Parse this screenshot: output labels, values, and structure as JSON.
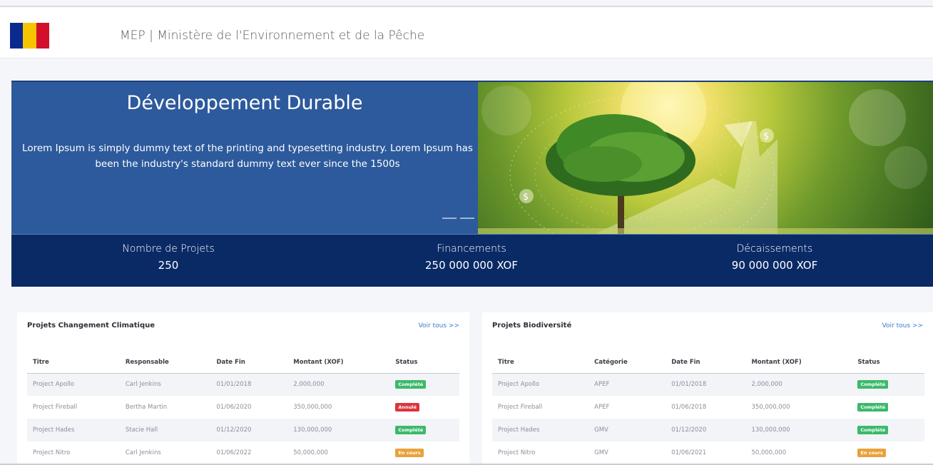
{
  "header": {
    "title": "MEP | Ministère de l'Environnement et de la Pêche",
    "flag_colors": [
      "#0b2a8e",
      "#f6c500",
      "#d2102b"
    ]
  },
  "hero": {
    "title": "Développement Durable",
    "text": "Lorem Ipsum is simply dummy text of the printing and typesetting industry. Lorem Ipsum has been the industry's standard dummy text ever since the 1500s",
    "slides_count": 4,
    "active_slide": 4,
    "image_icon": "money-growth-tree-image"
  },
  "stats": [
    {
      "label": "Nombre de Projets",
      "value": "250"
    },
    {
      "label": "Financements",
      "value": "250 000 000 XOF"
    },
    {
      "label": "Décaissements",
      "value": "90 000 000 XOF"
    }
  ],
  "status_colors": {
    "Complété": "#3cb96b",
    "Annulé": "#d9363e",
    "En cours": "#e8a23a"
  },
  "cards": [
    {
      "title": "Projets Changement Climatique",
      "link": "Voir tous >>",
      "columns": [
        "Titre",
        "Responsable",
        "Date Fin",
        "Montant (XOF)",
        "Status"
      ],
      "rows": [
        [
          "Project Apollo",
          "Carl Jenkins",
          "01/01/2018",
          "2,000,000",
          "Complété"
        ],
        [
          "Project Fireball",
          "Bertha Martin",
          "01/06/2020",
          "350,000,000",
          "Annulé"
        ],
        [
          "Project Hades",
          "Stacie Hall",
          "01/12/2020",
          "130,000,000",
          "Complété"
        ],
        [
          "Project Nitro",
          "Carl Jenkins",
          "01/06/2022",
          "50,000,000",
          "En cours"
        ]
      ]
    },
    {
      "title": "Projets Biodiversité",
      "link": "Voir tous >>",
      "columns": [
        "Titre",
        "Catégorie",
        "Date Fin",
        "Montant (XOF)",
        "Status"
      ],
      "rows": [
        [
          "Project Apollo",
          "APEF",
          "01/01/2018",
          "2,000,000",
          "Complété"
        ],
        [
          "Project Fireball",
          "APEF",
          "01/06/2018",
          "350,000,000",
          "Complété"
        ],
        [
          "Project Hades",
          "GMV",
          "01/12/2020",
          "130,000,000",
          "Complété"
        ],
        [
          "Project Nitro",
          "GMV",
          "01/06/2021",
          "50,000,000",
          "En cours"
        ]
      ]
    }
  ]
}
